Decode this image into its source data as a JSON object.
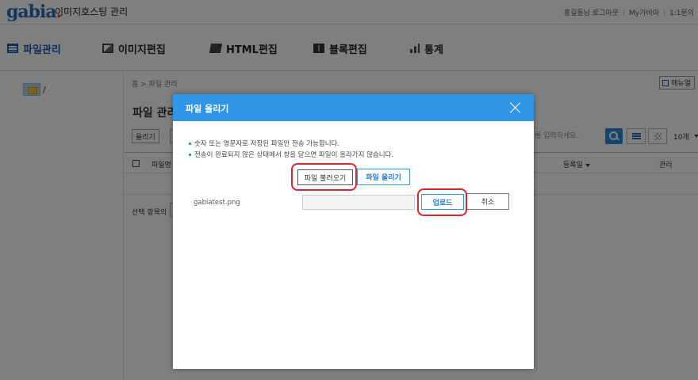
{
  "header": {
    "logo_text": "gabia",
    "logo_dot": ".",
    "app_title": "이미지호스팅 관리",
    "links": [
      "홍길동님 로그아웃",
      "My가비아",
      "1:1문의"
    ]
  },
  "nav": {
    "items": [
      {
        "label": "파일관리",
        "icon": "list-icon"
      },
      {
        "label": "이미지편집",
        "icon": "image-icon"
      },
      {
        "label": "HTML편집",
        "icon": "edit-icon"
      },
      {
        "label": "블록편집",
        "icon": "block-icon"
      },
      {
        "label": "통계",
        "icon": "stats-icon"
      }
    ]
  },
  "sidebar": {
    "folder_label": "/"
  },
  "content": {
    "breadcrumb": "홈 > 파일 관리",
    "manual_label": "매뉴얼",
    "page_title": "파일 관리",
    "upload_button": "올리기",
    "search_placeholder": "를 입력하세요.",
    "per_page": "10개",
    "table_headers": {
      "name": "파일명",
      "date": "등록일",
      "manage": "관리"
    },
    "selected_label": "선택 항목의"
  },
  "modal": {
    "title": "파일 올리기",
    "notices": [
      "숫자 또는 영문자로 저장된 파일만 전송 가능합니다.",
      "전송이 완료되지 않은 상태에서 창을 닫으면 파일이 올라가지 않습니다."
    ],
    "load_button": "파일 불러오기",
    "upload_file_button": "파일 올리기",
    "file_name": "gabiatest.png",
    "upload_button": "업로드",
    "cancel_button": "취소"
  },
  "colors": {
    "accent": "#2f95e6",
    "highlight": "#d9272e",
    "brand": "#2b6bb8"
  }
}
